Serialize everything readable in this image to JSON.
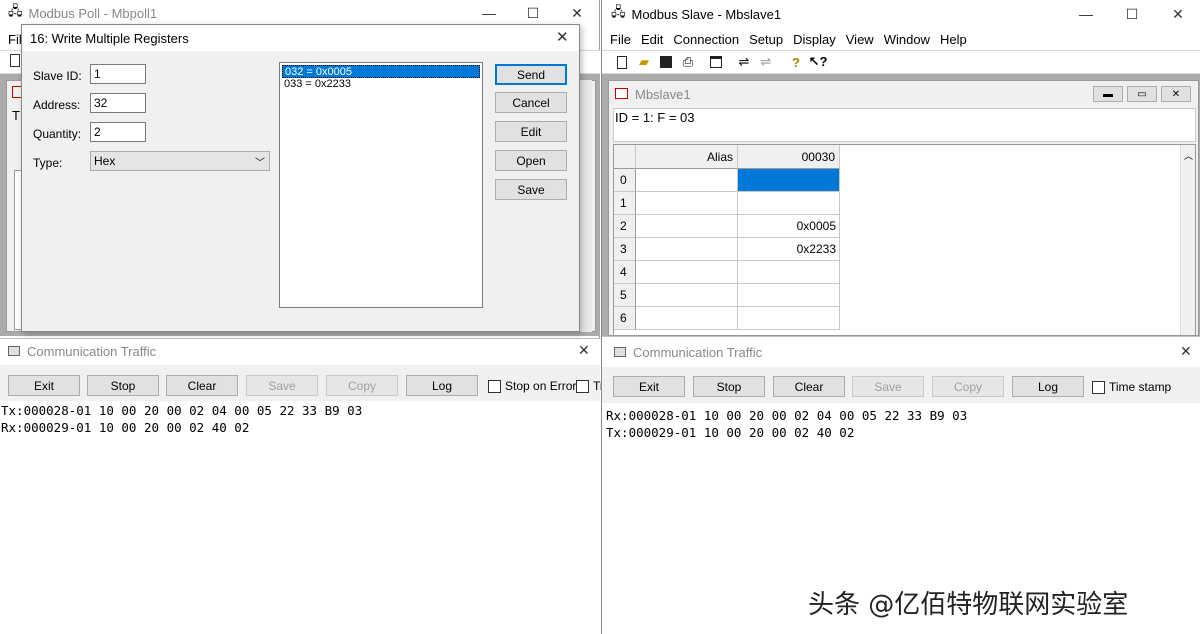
{
  "left_app": {
    "title": "Modbus Poll - Mbpoll1",
    "menu_partial": "Fil",
    "doc_fragment": "T"
  },
  "dialog": {
    "title": "16: Write Multiple Registers",
    "slave_id_label": "Slave ID:",
    "slave_id_value": "1",
    "address_label": "Address:",
    "address_value": "32",
    "quantity_label": "Quantity:",
    "quantity_value": "2",
    "type_label": "Type:",
    "type_value": "Hex",
    "registers": [
      "032 = 0x0005",
      "033 = 0x2233"
    ],
    "buttons": {
      "send": "Send",
      "cancel": "Cancel",
      "edit": "Edit",
      "open": "Open",
      "save": "Save"
    }
  },
  "left_traffic": {
    "title": "Communication Traffic",
    "buttons": {
      "exit": "Exit",
      "stop": "Stop",
      "clear": "Clear",
      "save": "Save",
      "copy": "Copy",
      "log": "Log"
    },
    "stop_on_error": "Stop on Error",
    "cut_label": "Ti",
    "lines": [
      "Tx:000028-01 10 00 20 00 02 04 00 05 22 33 B9 03",
      "Rx:000029-01 10 00 20 00 02 40 02"
    ]
  },
  "right_app": {
    "title": "Modbus Slave - Mbslave1",
    "menu": [
      "File",
      "Edit",
      "Connection",
      "Setup",
      "Display",
      "View",
      "Window",
      "Help"
    ],
    "child_title": "Mbslave1",
    "status_line": "ID = 1: F = 03",
    "grid": {
      "alias_header": "Alias",
      "col_header": "00030",
      "rows": [
        "0",
        "1",
        "2",
        "3",
        "4",
        "5",
        "6"
      ],
      "values": [
        "",
        "",
        "0x0005",
        "0x2233",
        "",
        "",
        ""
      ]
    }
  },
  "right_traffic": {
    "title": "Communication Traffic",
    "buttons": {
      "exit": "Exit",
      "stop": "Stop",
      "clear": "Clear",
      "save": "Save",
      "copy": "Copy",
      "log": "Log"
    },
    "time_stamp": "Time stamp",
    "lines": [
      "Rx:000028-01 10 00 20 00 02 04 00 05 22 33 B9 03",
      "Tx:000029-01 10 00 20 00 02 40 02"
    ]
  },
  "watermark": "头条 @亿佰特物联网实验室",
  "colors": {
    "selection": "#0078d7",
    "panel": "#f0f0f0",
    "border": "#a0a0a0"
  }
}
